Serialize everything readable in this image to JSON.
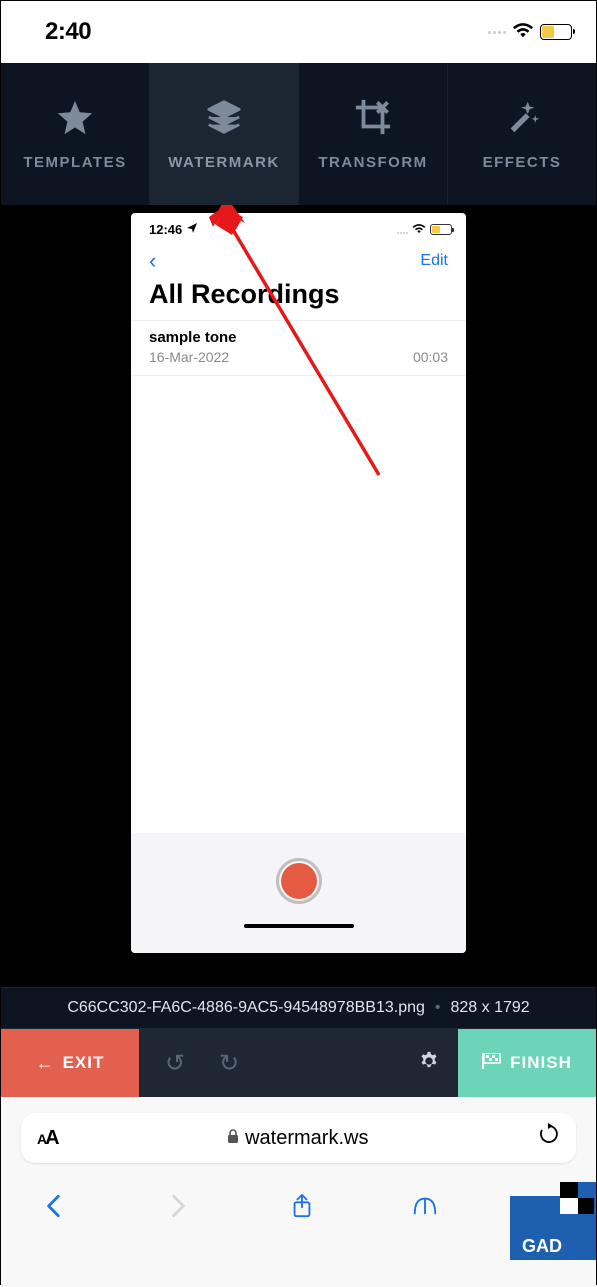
{
  "outer_status": {
    "time": "2:40"
  },
  "tabs": {
    "templates": "TEMPLATES",
    "watermark": "WATERMARK",
    "transform": "TRANSFORM",
    "effects": "EFFECTS"
  },
  "inner": {
    "time": "12:46",
    "nav": {
      "back_glyph": "‹",
      "edit": "Edit"
    },
    "title": "All Recordings",
    "item": {
      "name": "sample tone",
      "date": "16-Mar-2022",
      "duration": "00:03"
    }
  },
  "file_bar": {
    "name": "C66CC302-FA6C-4886-9AC5-94548978BB13.png",
    "dims": "828 x 1792"
  },
  "actions": {
    "exit_arrow": "←",
    "exit": "EXIT",
    "undo_glyph": "↺",
    "redo_glyph": "↻",
    "finish": "FINISH"
  },
  "safari": {
    "aa_small": "A",
    "aa_big": "A",
    "domain": "watermark.ws"
  },
  "logo_text": "GAD"
}
